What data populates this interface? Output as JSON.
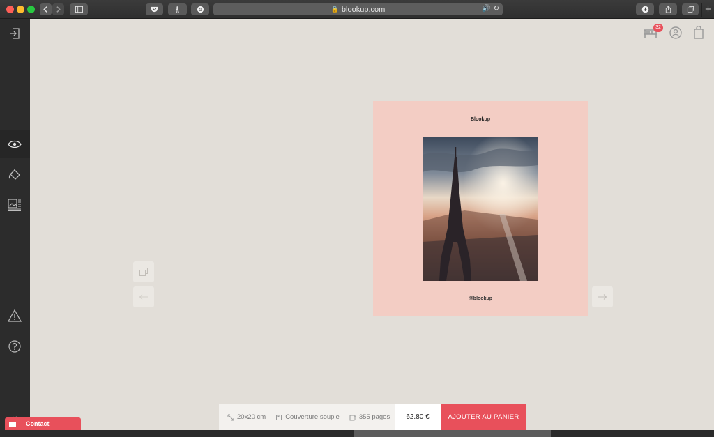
{
  "browser": {
    "url": "blookup.com"
  },
  "header": {
    "notification_count": "32"
  },
  "book": {
    "title": "Blookup",
    "handle": "@blookup"
  },
  "product": {
    "size": "20x20 cm",
    "cover": "Couverture souple",
    "pages": "355 pages",
    "price": "62.80 €",
    "add_to_cart": "AJOUTER AU PANIER"
  },
  "sidebar": {
    "brand": "blook",
    "contact": "Contact"
  },
  "colors": {
    "accent": "#e8505b",
    "book_background": "#f3cdc4",
    "canvas": "#e2ded8",
    "sidebar": "#2c2c2c"
  }
}
